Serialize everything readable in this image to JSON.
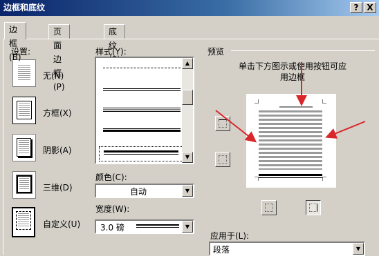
{
  "window": {
    "title": "边框和底纹",
    "help_btn": "?",
    "close_btn": "X"
  },
  "tabs": [
    {
      "label": "边框(B)",
      "active": true
    },
    {
      "label": "页面边框(P)",
      "active": false
    },
    {
      "label": "底纹(S)",
      "active": false
    }
  ],
  "settings": {
    "label": "设置:",
    "items": [
      {
        "label": "无(N)",
        "icon": "none-border-icon"
      },
      {
        "label": "方框(X)",
        "icon": "box-border-icon"
      },
      {
        "label": "阴影(A)",
        "icon": "shadow-border-icon"
      },
      {
        "label": "三维(D)",
        "icon": "3d-border-icon"
      },
      {
        "label": "自定义(U)",
        "icon": "custom-border-icon"
      }
    ],
    "selected": "自定义(U)"
  },
  "style": {
    "label": "样式(Y):",
    "items": [
      "dash-dot",
      "double",
      "triple-thin",
      "thick-thin",
      "thin-thick"
    ]
  },
  "color": {
    "label": "颜色(C):",
    "value": "自动"
  },
  "width": {
    "label": "宽度(W):",
    "value": "3.0 磅"
  },
  "preview": {
    "label": "预览",
    "hint": "单击下方图示或使用按钮可应用边框",
    "annotation_color": "#d9262b"
  },
  "apply_to": {
    "label": "应用于(L):",
    "value": "段落"
  }
}
